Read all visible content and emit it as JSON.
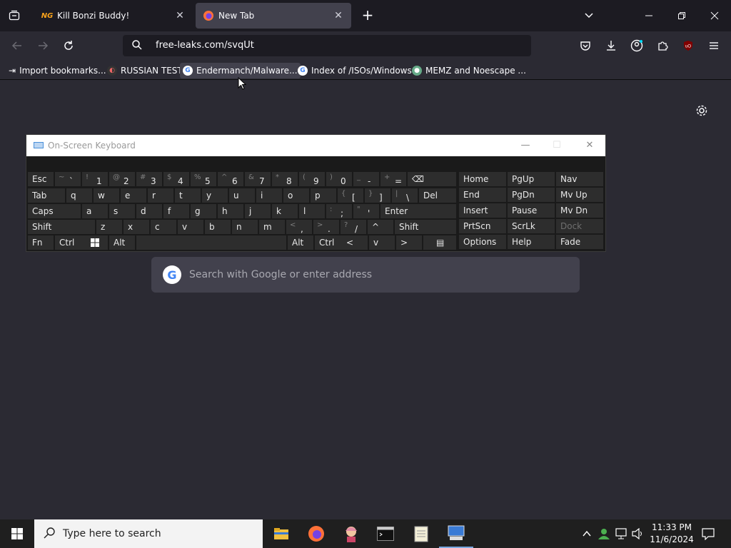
{
  "tabs": [
    {
      "title": "Kill Bonzi Buddy!",
      "favicon": "ng-icon"
    },
    {
      "title": "New Tab",
      "favicon": "firefox-icon",
      "active": true
    }
  ],
  "address": "free-leaks.com/svqUt",
  "bookmarks": [
    {
      "label": "Import bookmarks..."
    },
    {
      "label": "RUSSIAN TEST"
    },
    {
      "label": "Endermanch/Malware..."
    },
    {
      "label": "Index of /ISOs/Windows"
    },
    {
      "label": "MEMZ and Noescape ..."
    }
  ],
  "search": {
    "placeholder": "Search with Google or enter address",
    "logo": "G"
  },
  "osk": {
    "title": "On-Screen Keyboard",
    "row1": [
      [
        "Esc",
        ""
      ],
      [
        "~",
        "`"
      ],
      [
        "!",
        "1"
      ],
      [
        "@",
        "2"
      ],
      [
        "#",
        "3"
      ],
      [
        "$",
        "4"
      ],
      [
        "%",
        "5"
      ],
      [
        "^",
        "6"
      ],
      [
        "&",
        "7"
      ],
      [
        "*",
        "8"
      ],
      [
        "(",
        "9"
      ],
      [
        ")",
        "0"
      ],
      [
        "_",
        "-"
      ],
      [
        "+",
        "="
      ]
    ],
    "row2": [
      "Tab",
      "q",
      "w",
      "e",
      "r",
      "t",
      "y",
      "u",
      "i",
      "o",
      "p",
      "[",
      "]",
      "\\",
      "Del"
    ],
    "row2_shift": [
      "",
      "",
      "",
      "",
      "",
      "",
      "",
      "",
      "",
      "",
      "",
      "{",
      "}",
      "|",
      ""
    ],
    "row3": [
      "Caps",
      "a",
      "s",
      "d",
      "f",
      "g",
      "h",
      "j",
      "k",
      "l",
      ";",
      "'",
      "Enter"
    ],
    "row3_shift": [
      "",
      "",
      "",
      "",
      "",
      "",
      "",
      "",
      "",
      "",
      ":",
      "\"",
      ""
    ],
    "row4": [
      "Shift",
      "z",
      "x",
      "c",
      "v",
      "b",
      "n",
      "m",
      ",",
      ".",
      "/",
      "^",
      "Shift"
    ],
    "row4_shift": [
      "",
      "",
      "",
      "",
      "",
      "",
      "",
      "",
      "<",
      ">",
      "?",
      "",
      ""
    ],
    "row5": [
      "Fn",
      "Ctrl",
      "",
      "Alt",
      "",
      "Alt",
      "Ctrl",
      "<",
      "v",
      ">",
      ""
    ],
    "nav": [
      [
        "Home",
        "PgUp",
        "Nav"
      ],
      [
        "End",
        "PgDn",
        "Mv Up"
      ],
      [
        "Insert",
        "Pause",
        "Mv Dn"
      ],
      [
        "PrtScn",
        "ScrLk",
        "Dock"
      ],
      [
        "Options",
        "Help",
        "Fade"
      ]
    ]
  },
  "taskbar": {
    "search_placeholder": "Type here to search",
    "time": "11:33 PM",
    "date": "11/6/2024"
  }
}
